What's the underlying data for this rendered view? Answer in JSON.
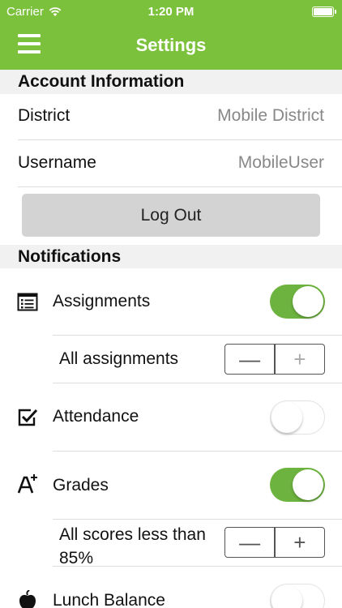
{
  "status_bar": {
    "carrier": "Carrier",
    "time": "1:20 PM"
  },
  "header": {
    "title": "Settings"
  },
  "account": {
    "section_title": "Account Information",
    "district_label": "District",
    "district_value": "Mobile District",
    "username_label": "Username",
    "username_value": "MobileUser",
    "logout_label": "Log Out"
  },
  "notifications": {
    "section_title": "Notifications",
    "assignments": {
      "label": "Assignments",
      "enabled": true,
      "icon": "list-icon"
    },
    "assignments_filter": {
      "label": "All assignments",
      "minus": "—",
      "plus": "+"
    },
    "attendance": {
      "label": "Attendance",
      "enabled": false,
      "icon": "checkbox-icon"
    },
    "grades": {
      "label": "Grades",
      "enabled": true,
      "icon": "grade-a-plus-icon"
    },
    "grades_filter": {
      "label": "All scores less than 85%",
      "minus": "—",
      "plus": "+"
    },
    "lunch_balance": {
      "label": "Lunch Balance",
      "enabled": false,
      "icon": "apple-icon"
    }
  },
  "colors": {
    "accent": "#7cc13c",
    "toggle_on": "#6db33f"
  }
}
